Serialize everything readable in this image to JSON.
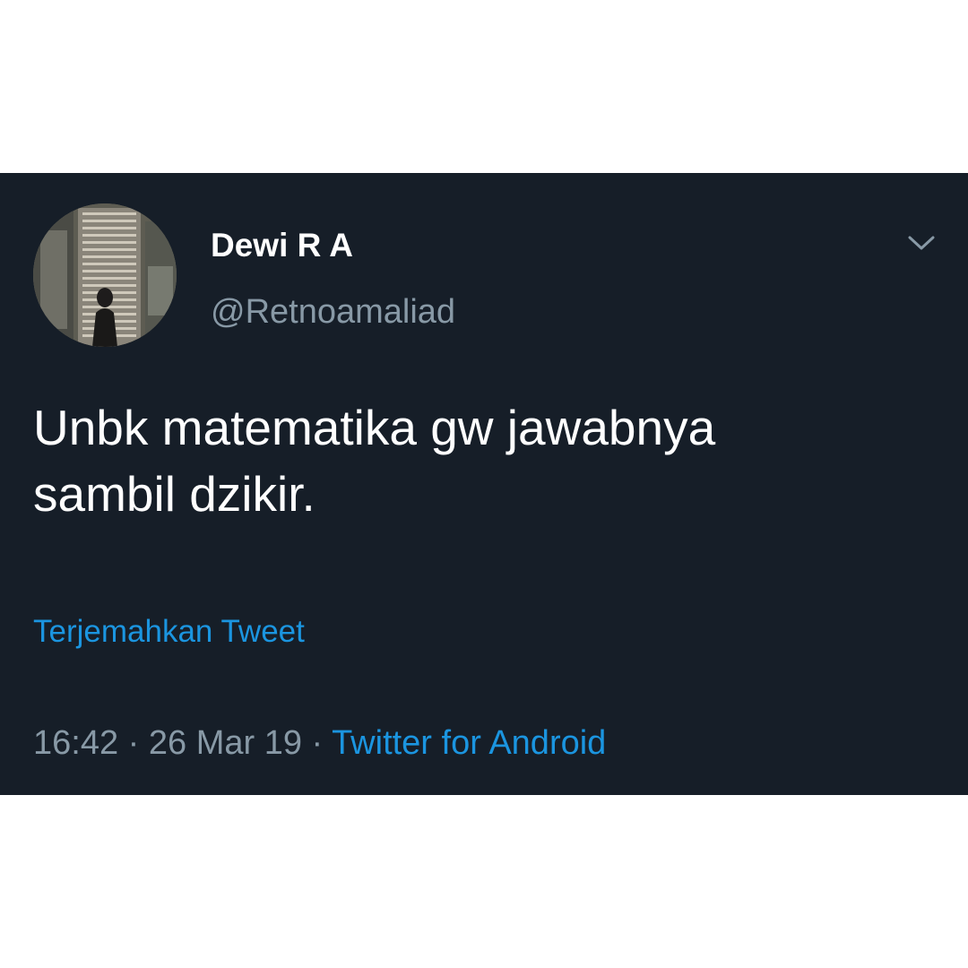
{
  "tweet": {
    "author": {
      "display_name": "Dewi R A",
      "handle": "@Retnoamaliad"
    },
    "text_line1": "Unbk matematika gw jawabnya",
    "text_line2": "sambil dzikir.",
    "translate_label": "Terjemahkan Tweet",
    "time": "16:42",
    "separator": " · ",
    "date": "26 Mar 19",
    "source": "Twitter for Android",
    "menu_icon": "chevron-down-icon",
    "avatar_icon": "avatar"
  },
  "colors": {
    "background": "#161e28",
    "text": "#ffffff",
    "secondary": "#8899a6",
    "link": "#1b95e0"
  }
}
